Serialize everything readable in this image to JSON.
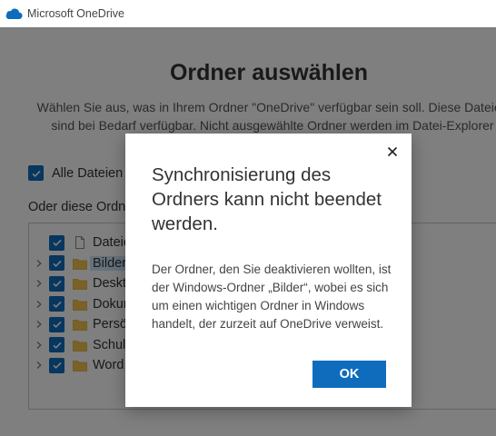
{
  "window": {
    "app_title": "Microsoft OneDrive"
  },
  "background": {
    "heading": "Ordner auswählen",
    "description_line1": "Wählen Sie aus, was in Ihrem Ordner \"OneDrive\" verfügbar sein soll. Diese Dateien",
    "description_line2": "sind bei Bedarf verfügbar. Nicht ausgewählte Ordner werden im Datei-Explorer",
    "all_files_label": "Alle Dateien",
    "or_these_label": "Oder diese Ordne",
    "folders": [
      {
        "name": "Dateie",
        "type": "file",
        "expandable": false,
        "checked": true,
        "selected": false
      },
      {
        "name": "Bilder",
        "type": "folder",
        "expandable": true,
        "checked": true,
        "selected": true
      },
      {
        "name": "Deskto",
        "type": "folder",
        "expandable": true,
        "checked": true,
        "selected": false
      },
      {
        "name": "Dokun",
        "type": "folder",
        "expandable": true,
        "checked": true,
        "selected": false
      },
      {
        "name": "Persö",
        "type": "folder",
        "expandable": true,
        "checked": true,
        "selected": false
      },
      {
        "name": "Schule",
        "type": "folder",
        "expandable": true,
        "checked": true,
        "selected": false
      },
      {
        "name": "Word",
        "type": "folder",
        "expandable": true,
        "checked": true,
        "selected": false
      }
    ]
  },
  "dialog": {
    "title": "Synchronisierung des Ordners kann nicht beendet werden.",
    "body": "Der Ordner, den Sie deaktivieren wollten, ist der Windows-Ordner „Bilder“, wobei es sich um einen wichtigen Ordner in Windows handelt, der zurzeit auf OneDrive verweist.",
    "ok_label": "OK"
  },
  "colors": {
    "accent": "#0f6cbd",
    "folder": "#f4c44e",
    "overlay": "rgba(0,0,0,0.5)",
    "selection": "#cce4f7"
  },
  "icons": {
    "app": "onedrive-cloud-icon",
    "close": "close-icon",
    "folder": "folder-icon",
    "file": "file-icon",
    "expand": "chevron-right-icon",
    "check": "checkmark-icon"
  }
}
